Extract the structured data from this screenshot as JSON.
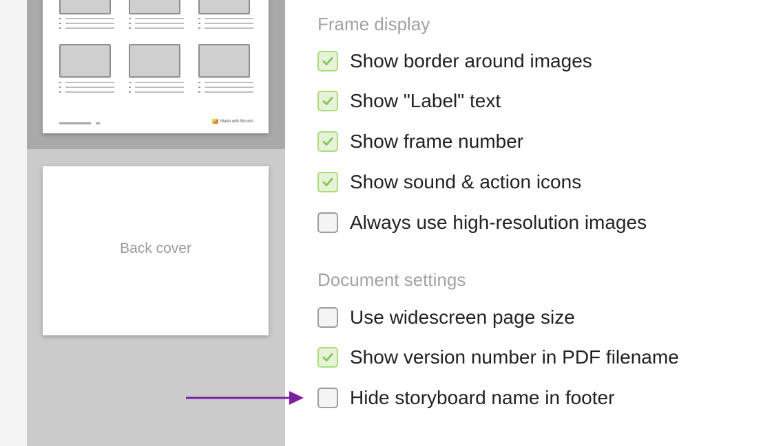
{
  "preview": {
    "back_cover_label": "Back cover",
    "brand_label": "Made with Boords"
  },
  "settings": {
    "frame_display": {
      "heading": "Frame display",
      "options": [
        {
          "label": "Show border around images",
          "checked": true
        },
        {
          "label": "Show \"Label\" text",
          "checked": true
        },
        {
          "label": "Show frame number",
          "checked": true
        },
        {
          "label": "Show sound & action icons",
          "checked": true
        },
        {
          "label": "Always use high-resolution images",
          "checked": false
        }
      ]
    },
    "document_settings": {
      "heading": "Document settings",
      "options": [
        {
          "label": "Use widescreen page size",
          "checked": false
        },
        {
          "label": "Show version number in PDF filename",
          "checked": true
        },
        {
          "label": "Hide storyboard name in footer",
          "checked": false
        }
      ]
    }
  },
  "colors": {
    "checked_border": "#a8dc7d",
    "checked_fill": "#e6f3d7",
    "checkmark": "#8cc85a",
    "arrow": "#7b1fa2"
  }
}
